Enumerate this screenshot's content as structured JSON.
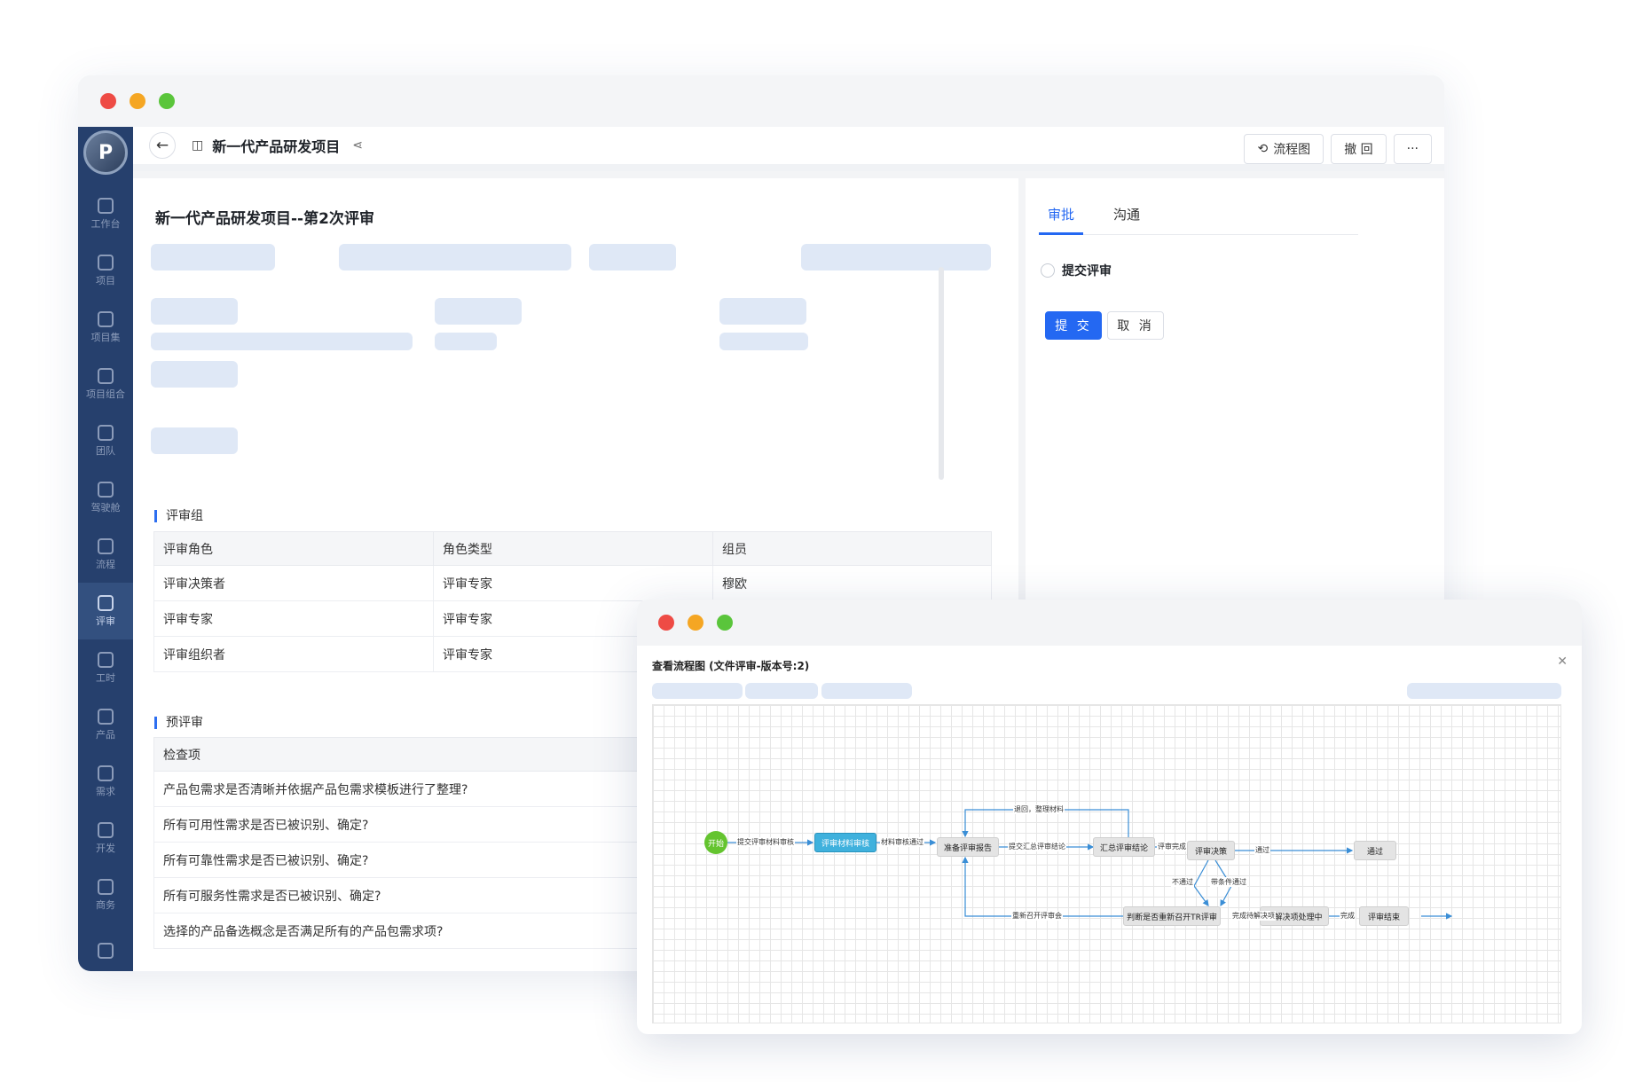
{
  "window": {
    "dots": [
      "close",
      "minimize",
      "maximize"
    ]
  },
  "sidebar": {
    "logo": "P",
    "items": [
      {
        "label": "工作台",
        "icon": "home-icon"
      },
      {
        "label": "项目",
        "icon": "kanban-icon"
      },
      {
        "label": "项目集",
        "icon": "hierarchy-icon"
      },
      {
        "label": "项目组合",
        "icon": "gauge-icon"
      },
      {
        "label": "团队",
        "icon": "team-icon"
      },
      {
        "label": "驾驶舱",
        "icon": "alarm-icon"
      },
      {
        "label": "流程",
        "icon": "flow-icon"
      },
      {
        "label": "评审",
        "icon": "review-icon"
      },
      {
        "label": "工时",
        "icon": "clock-icon"
      },
      {
        "label": "产品",
        "icon": "product-icon"
      },
      {
        "label": "需求",
        "icon": "requirement-icon"
      },
      {
        "label": "开发",
        "icon": "terminal-icon"
      },
      {
        "label": "商务",
        "icon": "business-icon"
      },
      {
        "label": "",
        "icon": "book-icon"
      }
    ],
    "active_index": 7
  },
  "header": {
    "back_icon": "←",
    "project_icon": "◫",
    "title": "新一代产品研发项目",
    "share_icon": "⋖",
    "flow_btn": "流程图",
    "flow_icon": "⟲",
    "withdraw_btn": "撤 回",
    "more_btn": "···"
  },
  "review": {
    "title": "新一代产品研发项目--第2次评审",
    "group_section": "评审组",
    "group_table": {
      "headers": [
        "评审角色",
        "角色类型",
        "组员"
      ],
      "rows": [
        [
          "评审决策者",
          "评审专家",
          "穆欧"
        ],
        [
          "评审专家",
          "评审专家",
          ""
        ],
        [
          "评审组织者",
          "评审专家",
          ""
        ]
      ]
    },
    "pre_section": "预评审",
    "check_table": {
      "header": "检查项",
      "rows": [
        "产品包需求是否清晰并依据产品包需求模板进行了整理?",
        "所有可用性需求是否已被识别、确定?",
        "所有可靠性需求是否已被识别、确定?",
        "所有可服务性需求是否已被识别、确定?",
        "选择的产品备选概念是否满足所有的产品包需求项?"
      ]
    }
  },
  "right_panel": {
    "tabs": [
      "审批",
      "沟通"
    ],
    "radio_label": "提交评审",
    "submit": "提 交",
    "cancel": "取 消"
  },
  "flow_dialog": {
    "title": "查看流程图 (文件评审-版本号:2)",
    "close_icon": "✕",
    "nodes": {
      "start": "开始",
      "material": "评审材料审核",
      "prepare": "准备评审报告",
      "summary": "汇总评审结论",
      "decision": "评审决策",
      "pass": "通过",
      "reopen": "判断是否重新召开TR评审",
      "pending": "待解决项处理中",
      "end": "评审结束"
    },
    "edges": {
      "submit_material": "提交评审材料审核",
      "material_pass": "材料审核通过",
      "back_organize": "退回，整理材料",
      "submit_summary": "提交汇总评审结论",
      "review_done": "评审完成",
      "passed": "通过",
      "not_passed": "不通过",
      "conditional": "带条件通过",
      "reconvene": "重新召开评审会",
      "finish_items": "完成待解决项",
      "done": "完成"
    }
  }
}
